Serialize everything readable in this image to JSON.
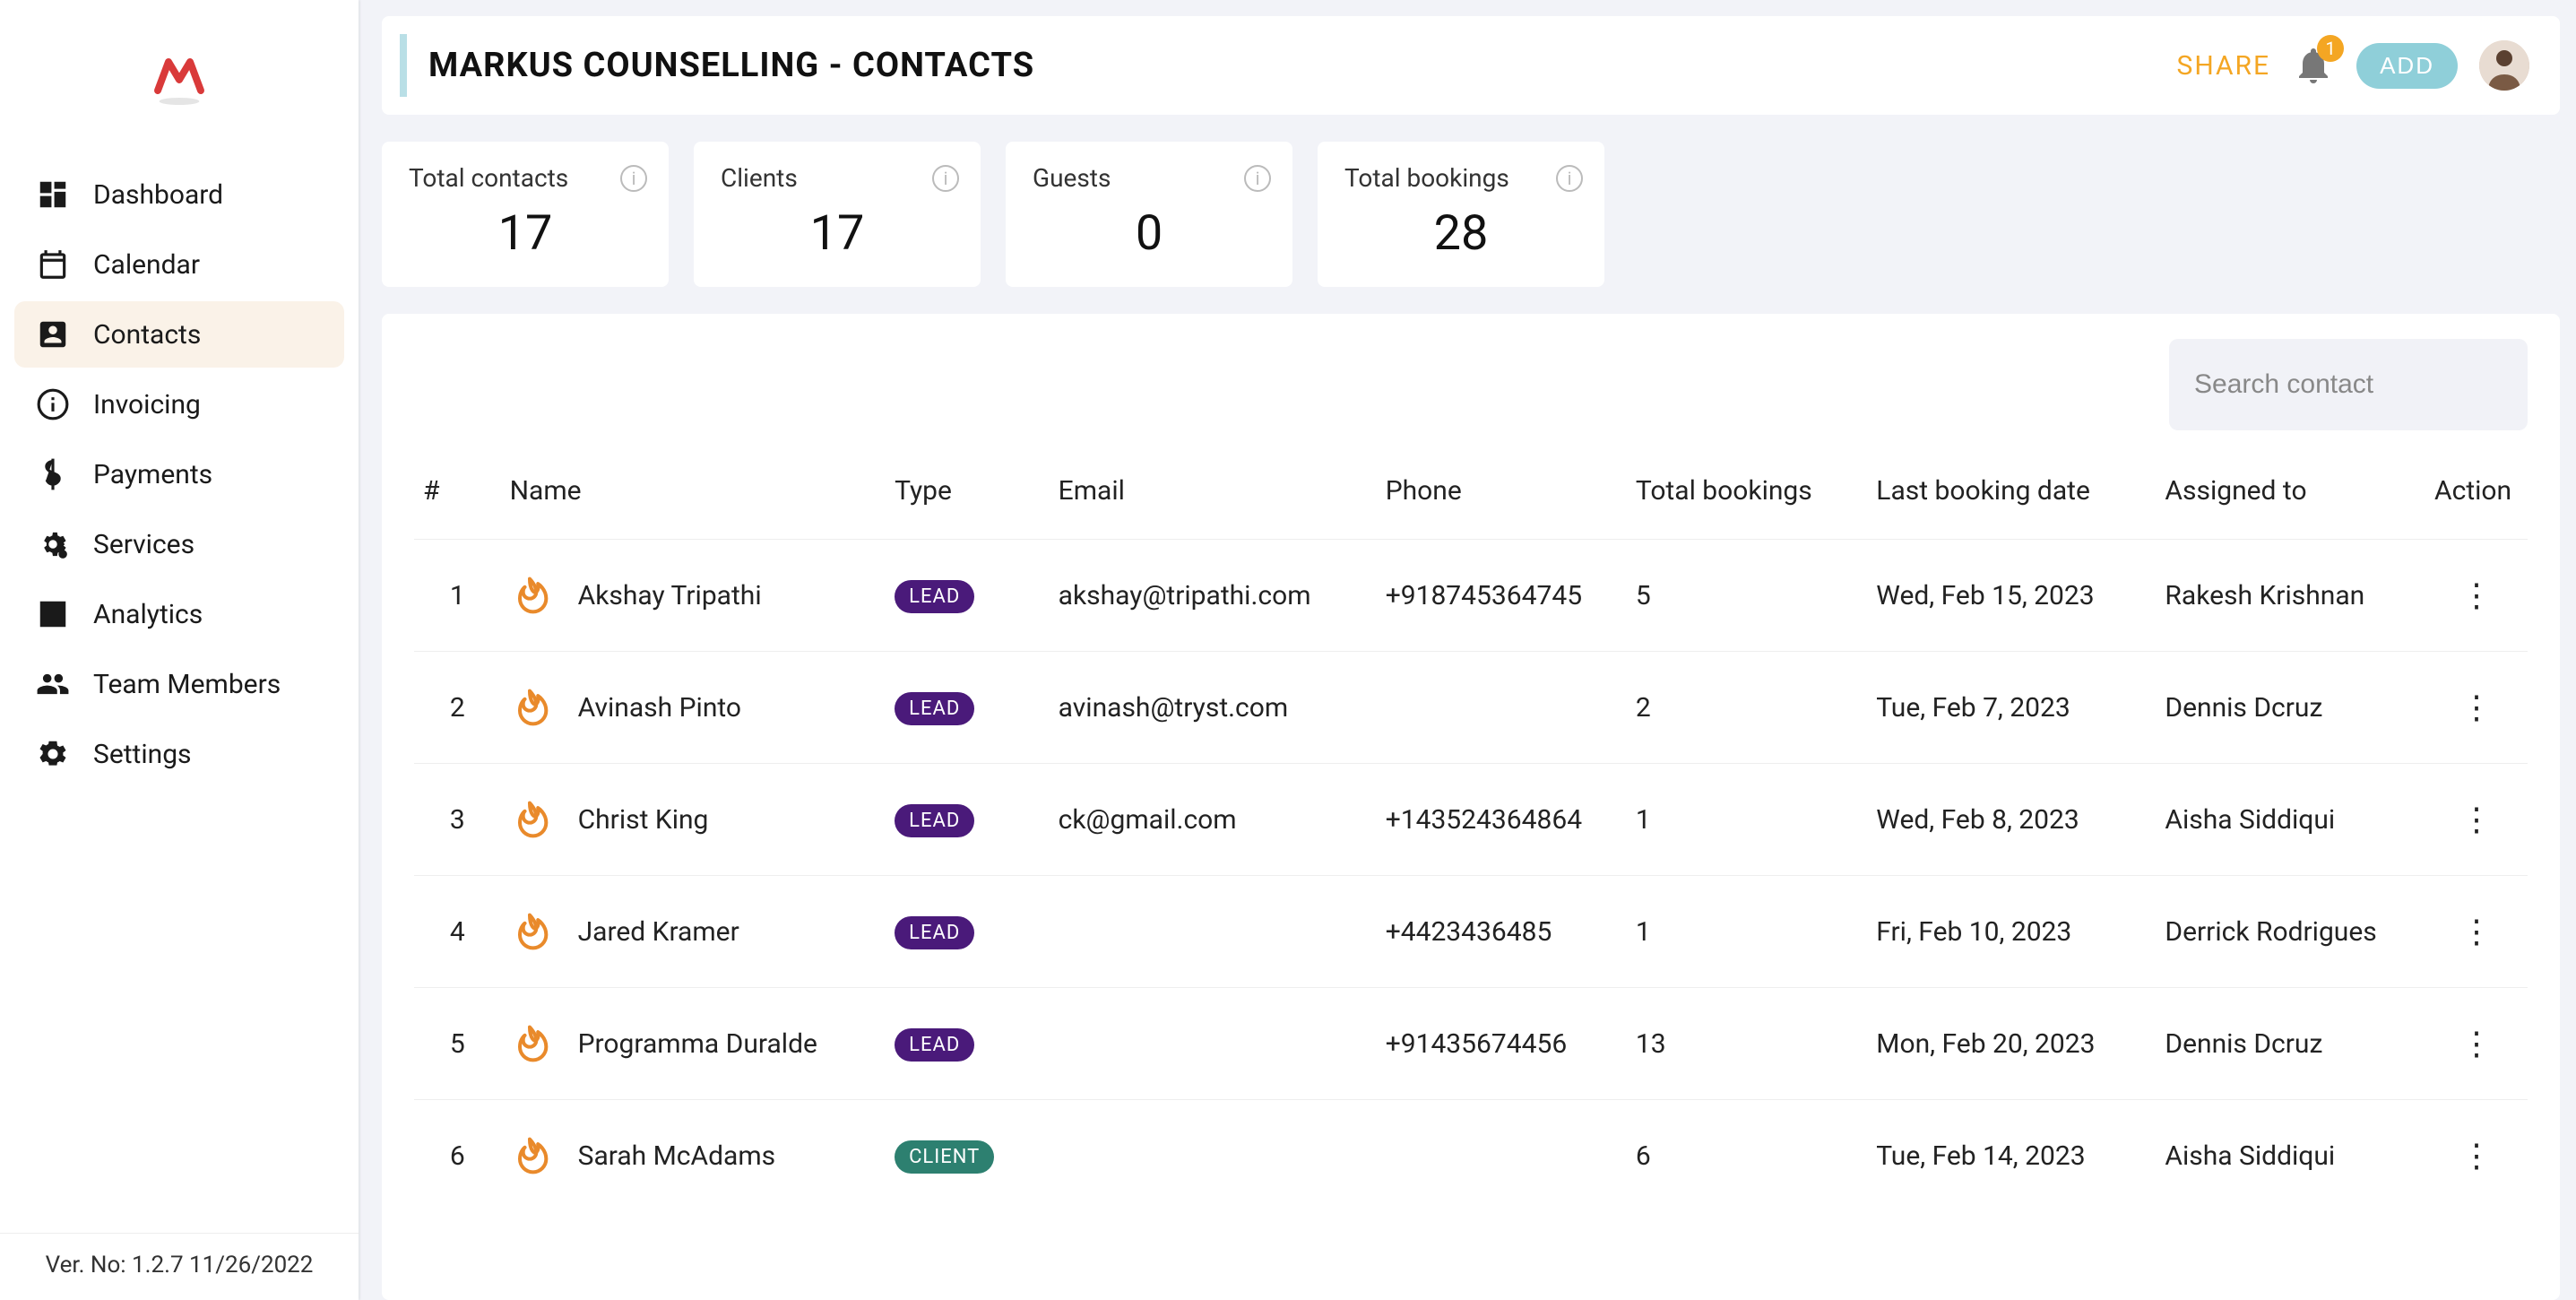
{
  "sidebar": {
    "version": "Ver. No: 1.2.7 11/26/2022",
    "items": [
      {
        "label": "Dashboard",
        "name": "dashboard"
      },
      {
        "label": "Calendar",
        "name": "calendar"
      },
      {
        "label": "Contacts",
        "name": "contacts"
      },
      {
        "label": "Invoicing",
        "name": "invoicing"
      },
      {
        "label": "Payments",
        "name": "payments"
      },
      {
        "label": "Services",
        "name": "services"
      },
      {
        "label": "Analytics",
        "name": "analytics"
      },
      {
        "label": "Team Members",
        "name": "team-members"
      },
      {
        "label": "Settings",
        "name": "settings"
      }
    ],
    "active_index": 2
  },
  "header": {
    "title": "MARKUS COUNSELLING - CONTACTS",
    "share_label": "SHARE",
    "add_label": "ADD",
    "notification_count": "1"
  },
  "stats": [
    {
      "label": "Total contacts",
      "value": "17"
    },
    {
      "label": "Clients",
      "value": "17"
    },
    {
      "label": "Guests",
      "value": "0"
    },
    {
      "label": "Total bookings",
      "value": "28"
    }
  ],
  "search": {
    "placeholder": "Search contact"
  },
  "table": {
    "columns": [
      "#",
      "Name",
      "Type",
      "Email",
      "Phone",
      "Total bookings",
      "Last booking date",
      "Assigned to",
      "Action"
    ],
    "rows": [
      {
        "num": "1",
        "name": "Akshay Tripathi",
        "type": "LEAD",
        "type_class": "lead",
        "email": "akshay@tripathi.com",
        "phone": "+918745364745",
        "bookings": "5",
        "last": "Wed, Feb 15, 2023",
        "assigned": "Rakesh Krishnan"
      },
      {
        "num": "2",
        "name": "Avinash Pinto",
        "type": "LEAD",
        "type_class": "lead",
        "email": "avinash@tryst.com",
        "phone": "",
        "bookings": "2",
        "last": "Tue, Feb 7, 2023",
        "assigned": "Dennis Dcruz"
      },
      {
        "num": "3",
        "name": "Christ King",
        "type": "LEAD",
        "type_class": "lead",
        "email": "ck@gmail.com",
        "phone": "+143524364864",
        "bookings": "1",
        "last": "Wed, Feb 8, 2023",
        "assigned": "Aisha Siddiqui"
      },
      {
        "num": "4",
        "name": "Jared Kramer",
        "type": "LEAD",
        "type_class": "lead",
        "email": "",
        "phone": "+4423436485",
        "bookings": "1",
        "last": "Fri, Feb 10, 2023",
        "assigned": "Derrick Rodrigues"
      },
      {
        "num": "5",
        "name": "Programma Duralde",
        "type": "LEAD",
        "type_class": "lead",
        "email": "",
        "phone": "+91435674456",
        "bookings": "13",
        "last": "Mon, Feb 20, 2023",
        "assigned": "Dennis Dcruz"
      },
      {
        "num": "6",
        "name": "Sarah McAdams",
        "type": "CLIENT",
        "type_class": "client",
        "email": "",
        "phone": "",
        "bookings": "6",
        "last": "Tue, Feb 14, 2023",
        "assigned": "Aisha Siddiqui"
      }
    ]
  }
}
